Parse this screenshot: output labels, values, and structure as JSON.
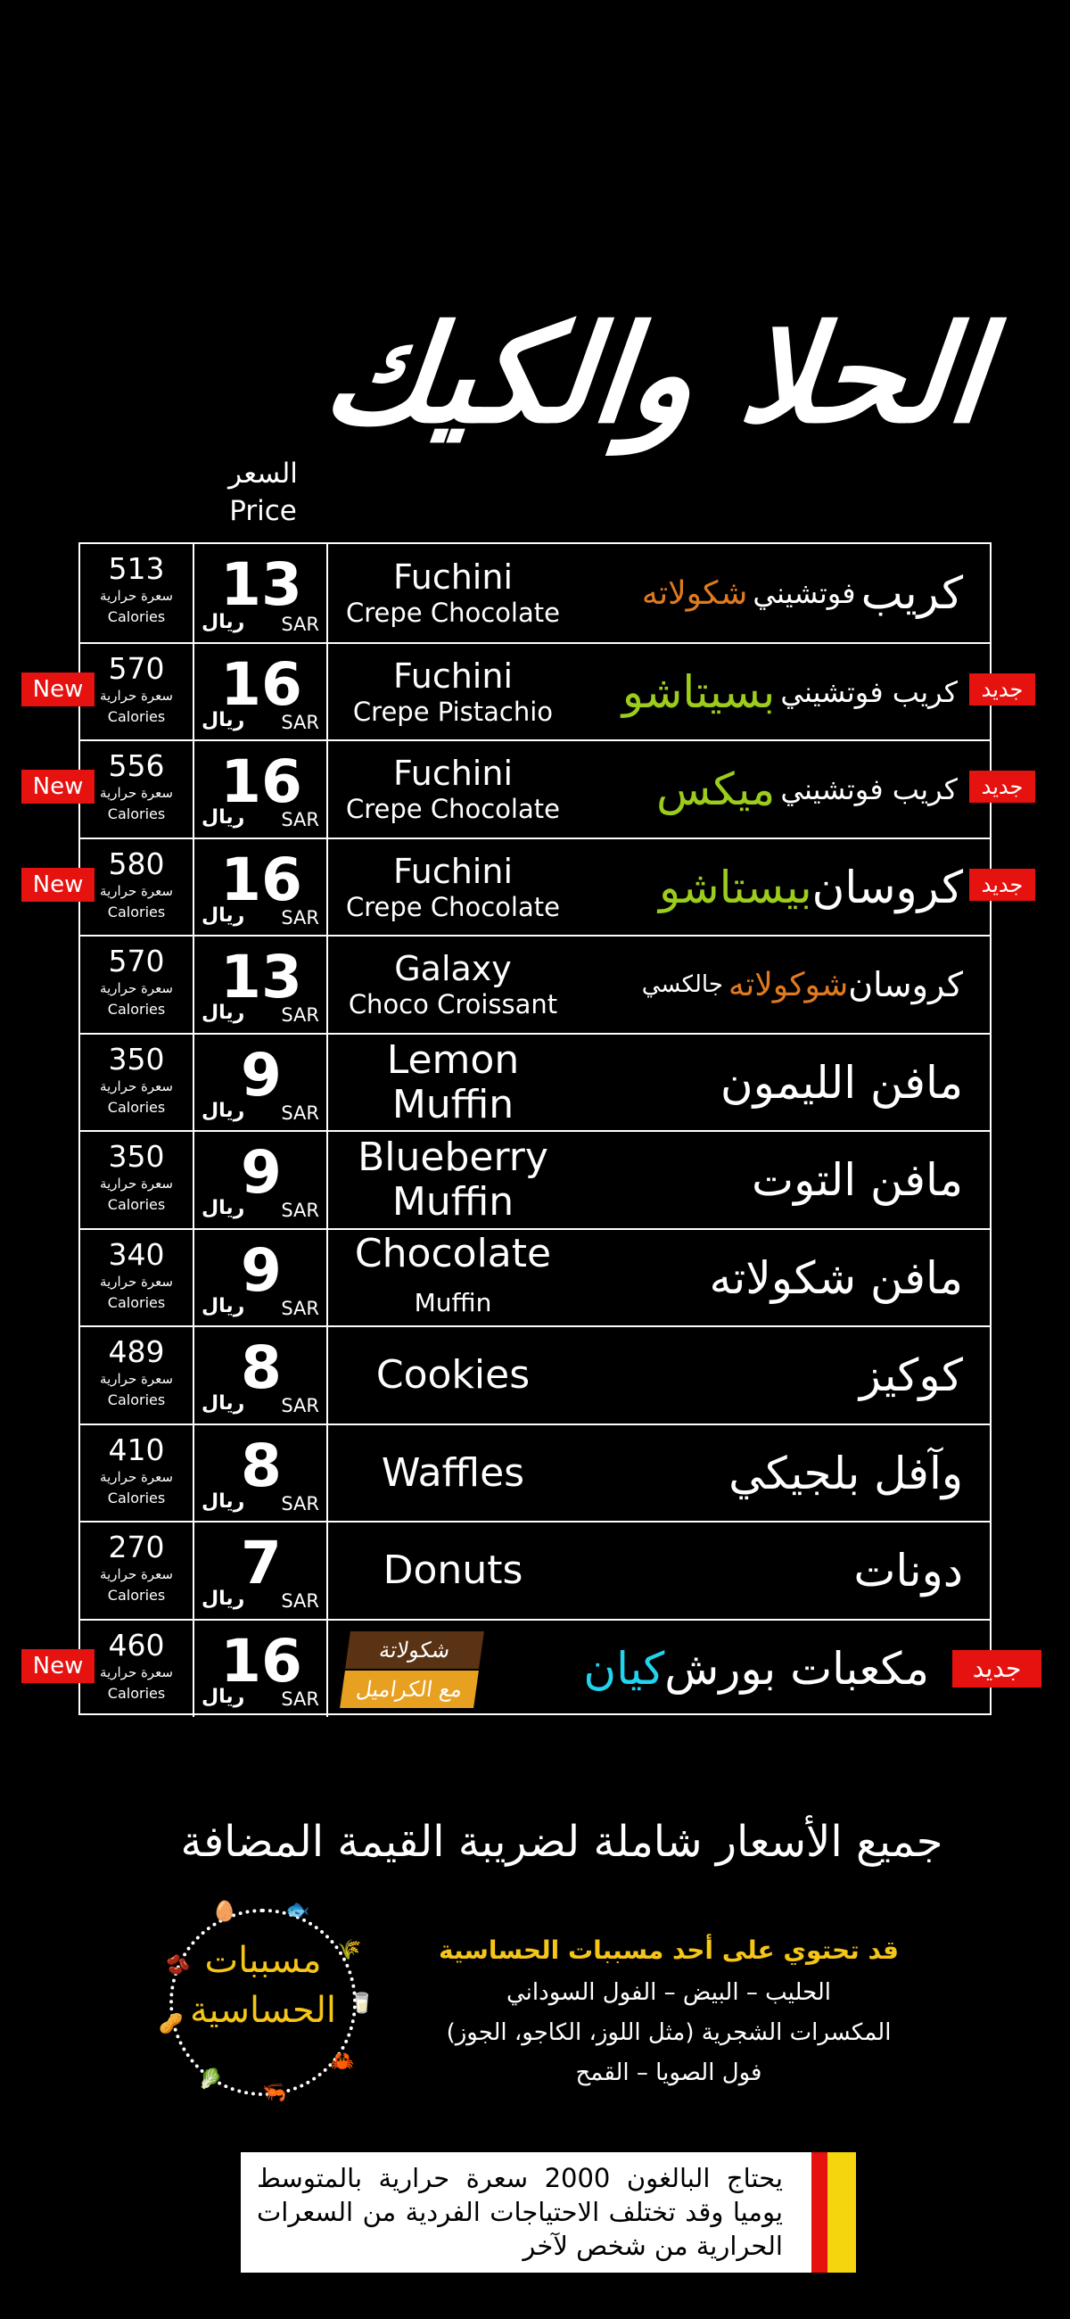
{
  "title": "الحلا والكيك",
  "price_header": {
    "ar": "السعر",
    "en": "Price"
  },
  "currency": {
    "ar": "ريال",
    "en": "SAR"
  },
  "calories_label": {
    "ar": "سعرة حرارية",
    "en": "Calories"
  },
  "new_badge": "New",
  "new_badge_ar": "جديد",
  "items": [
    {
      "calories": "513",
      "price": "13",
      "en_line1": "Fuchini",
      "en_line2": "Crepe Chocolate",
      "ar_main": "كريب",
      "ar_small": "فوتشيني",
      "ar_accent": "شكولاته",
      "accent_color": "#e07a1f",
      "is_new": false
    },
    {
      "calories": "570",
      "price": "16",
      "en_line1": "Fuchini",
      "en_line2": "Crepe Pistachio",
      "ar_small": "كريب فوتشيني",
      "ar_accent": "بسيتاشو",
      "accent_color": "#9ccc1c",
      "is_new": true
    },
    {
      "calories": "556",
      "price": "16",
      "en_line1": "Fuchini",
      "en_line2": "Crepe Chocolate",
      "ar_small": "كريب فوتشيني",
      "ar_accent": "ميكس",
      "accent_color": "#9ccc1c",
      "is_new": true
    },
    {
      "calories": "580",
      "price": "16",
      "en_line1": "Fuchini",
      "en_line2": "Crepe Chocolate",
      "ar_main": "كروسان",
      "ar_accent": "بيستاشو",
      "accent_color": "#9ccc1c",
      "is_new": true
    },
    {
      "calories": "570",
      "price": "13",
      "en_line1": "Galaxy",
      "en_line2": "Choco Croissant",
      "ar_main": "كروسان",
      "ar_accent": "شوكولاته",
      "ar_small": "جالكسي",
      "accent_color": "#e07a1f",
      "is_new": false
    },
    {
      "calories": "350",
      "price": "9",
      "en_single": "Lemon Muffin",
      "ar_main": "مافن الليمون",
      "is_new": false
    },
    {
      "calories": "350",
      "price": "9",
      "en_single": "Blueberry Muffin",
      "ar_main": "مافن التوت",
      "is_new": false
    },
    {
      "calories": "340",
      "price": "9",
      "en_single": "Chocolate",
      "en_small": "Muffin",
      "ar_main": "مافن شكولاته",
      "is_new": false
    },
    {
      "calories": "489",
      "price": "8",
      "en_single": "Cookies",
      "ar_main": "كوكيز",
      "is_new": false
    },
    {
      "calories": "410",
      "price": "8",
      "en_single": "Waffles",
      "ar_main": "وآفل بلجيكي",
      "is_new": false
    },
    {
      "calories": "270",
      "price": "7",
      "en_single": "Donuts",
      "ar_main": "دونات",
      "is_new": false
    },
    {
      "calories": "460",
      "price": "16",
      "tag1": "شكولاتة",
      "tag2": "مع الكراميل",
      "ar_main": "مكعبات بورش",
      "ar_accent": "كيان",
      "accent_color": "#22d3ee",
      "is_new": true
    }
  ],
  "vat_note": "جميع الأسعار شاملة لضريبة القيمة المضافة",
  "allergens": {
    "badge_title": "مسببات الحساسية",
    "header": "قد تحتوي على أحد مسببات الحساسية",
    "lines": [
      "الحليب – البيض – الفول السوداني",
      "المكسرات الشجرية (مثل اللوز، الكاجو، الجوز)",
      "فول الصويا – القمح"
    ]
  },
  "notice": "يحتاج البالغون 2000 سعرة حرارية بالمتوسط يوميا وقد تختلف الاحتياجات الفردية من السعرات الحرارية من شخص لآخر",
  "colors": {
    "background": "#000000",
    "new_badge": "#e5120f",
    "orange_accent": "#e07a1f",
    "green_accent": "#9ccc1c",
    "cyan_accent": "#22d3ee",
    "allergen_yellow": "#f5c518"
  }
}
